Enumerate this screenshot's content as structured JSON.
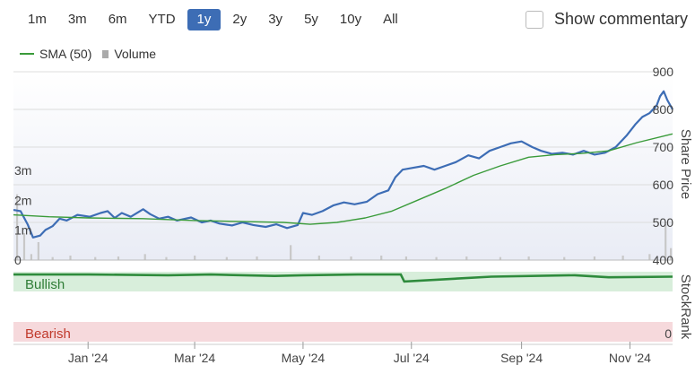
{
  "range_buttons": [
    "1m",
    "3m",
    "6m",
    "YTD",
    "1y",
    "2y",
    "3y",
    "5y",
    "10y",
    "All"
  ],
  "active_range": "1y",
  "commentary": {
    "label": "Show commentary",
    "checked": false
  },
  "legend": {
    "sma_label": "SMA (50)",
    "volume_label": "Volume"
  },
  "colors": {
    "price": "#3d6db5",
    "sma": "#3a9b3a",
    "stockrank": "#2e8b3c",
    "bullish_band": "#d8eedb",
    "bearish_band": "#f6d9dc",
    "volume": "#c8c8c8",
    "active_button": "#3d6db5"
  },
  "chart_data": {
    "type": "line",
    "price_axis": {
      "title": "Share Price",
      "ticks": [
        400,
        500,
        600,
        700,
        800,
        900
      ],
      "range": [
        400,
        900
      ]
    },
    "volume_axis": {
      "ticks": [
        "0",
        "1m",
        "2m",
        "3m"
      ],
      "values": [
        0,
        1,
        2,
        3
      ],
      "range": [
        0,
        3
      ]
    },
    "x_axis": {
      "tick_labels": [
        "Jan '24",
        "Mar '24",
        "May '24",
        "Jul '24",
        "Sep '24",
        "Nov '24"
      ],
      "tick_dates": [
        "2024-01-01",
        "2024-03-01",
        "2024-05-01",
        "2024-07-01",
        "2024-09-01",
        "2024-11-01"
      ],
      "range": [
        "2023-11-20",
        "2024-11-25"
      ]
    },
    "series": [
      {
        "name": "",
        "role": "price",
        "points": [
          [
            "2023-11-20",
            533
          ],
          [
            "2023-11-24",
            530
          ],
          [
            "2023-11-28",
            495
          ],
          [
            "2023-12-01",
            460
          ],
          [
            "2023-12-05",
            465
          ],
          [
            "2023-12-08",
            480
          ],
          [
            "2023-12-12",
            490
          ],
          [
            "2023-12-16",
            510
          ],
          [
            "2023-12-20",
            505
          ],
          [
            "2023-12-26",
            520
          ],
          [
            "2024-01-02",
            515
          ],
          [
            "2024-01-08",
            525
          ],
          [
            "2024-01-12",
            530
          ],
          [
            "2024-01-16",
            512
          ],
          [
            "2024-01-20",
            525
          ],
          [
            "2024-01-25",
            515
          ],
          [
            "2024-02-01",
            535
          ],
          [
            "2024-02-05",
            522
          ],
          [
            "2024-02-10",
            510
          ],
          [
            "2024-02-15",
            515
          ],
          [
            "2024-02-20",
            505
          ],
          [
            "2024-02-28",
            513
          ],
          [
            "2024-03-05",
            500
          ],
          [
            "2024-03-10",
            505
          ],
          [
            "2024-03-15",
            497
          ],
          [
            "2024-03-22",
            492
          ],
          [
            "2024-03-28",
            500
          ],
          [
            "2024-04-03",
            493
          ],
          [
            "2024-04-10",
            488
          ],
          [
            "2024-04-16",
            495
          ],
          [
            "2024-04-22",
            485
          ],
          [
            "2024-04-28",
            493
          ],
          [
            "2024-05-01",
            525
          ],
          [
            "2024-05-06",
            520
          ],
          [
            "2024-05-12",
            530
          ],
          [
            "2024-05-18",
            545
          ],
          [
            "2024-05-24",
            553
          ],
          [
            "2024-05-30",
            548
          ],
          [
            "2024-06-06",
            555
          ],
          [
            "2024-06-12",
            575
          ],
          [
            "2024-06-18",
            585
          ],
          [
            "2024-06-22",
            620
          ],
          [
            "2024-06-26",
            640
          ],
          [
            "2024-07-02",
            645
          ],
          [
            "2024-07-08",
            650
          ],
          [
            "2024-07-14",
            640
          ],
          [
            "2024-07-20",
            650
          ],
          [
            "2024-07-26",
            660
          ],
          [
            "2024-08-02",
            678
          ],
          [
            "2024-08-08",
            670
          ],
          [
            "2024-08-14",
            690
          ],
          [
            "2024-08-20",
            700
          ],
          [
            "2024-08-26",
            710
          ],
          [
            "2024-09-01",
            715
          ],
          [
            "2024-09-07",
            700
          ],
          [
            "2024-09-12",
            690
          ],
          [
            "2024-09-18",
            682
          ],
          [
            "2024-09-24",
            685
          ],
          [
            "2024-09-30",
            680
          ],
          [
            "2024-10-06",
            690
          ],
          [
            "2024-10-12",
            680
          ],
          [
            "2024-10-18",
            685
          ],
          [
            "2024-10-24",
            700
          ],
          [
            "2024-10-30",
            730
          ],
          [
            "2024-11-04",
            760
          ],
          [
            "2024-11-08",
            780
          ],
          [
            "2024-11-12",
            790
          ],
          [
            "2024-11-16",
            810
          ],
          [
            "2024-11-18",
            835
          ],
          [
            "2024-11-20",
            848
          ],
          [
            "2024-11-22",
            825
          ],
          [
            "2024-11-25",
            800
          ]
        ]
      },
      {
        "name": "SMA (50)",
        "role": "sma",
        "points": [
          [
            "2023-11-20",
            520
          ],
          [
            "2023-12-10",
            515
          ],
          [
            "2024-01-01",
            512
          ],
          [
            "2024-02-01",
            510
          ],
          [
            "2024-03-01",
            505
          ],
          [
            "2024-04-01",
            502
          ],
          [
            "2024-04-20",
            500
          ],
          [
            "2024-05-05",
            495
          ],
          [
            "2024-05-20",
            500
          ],
          [
            "2024-06-05",
            512
          ],
          [
            "2024-06-20",
            530
          ],
          [
            "2024-07-05",
            560
          ],
          [
            "2024-07-20",
            590
          ],
          [
            "2024-08-05",
            625
          ],
          [
            "2024-08-20",
            650
          ],
          [
            "2024-09-05",
            673
          ],
          [
            "2024-09-20",
            680
          ],
          [
            "2024-10-05",
            683
          ],
          [
            "2024-10-20",
            690
          ],
          [
            "2024-11-05",
            712
          ],
          [
            "2024-11-25",
            735
          ]
        ]
      }
    ],
    "volume": [
      [
        "2023-11-22",
        2.2
      ],
      [
        "2023-11-26",
        0.9
      ],
      [
        "2023-11-30",
        0.2
      ],
      [
        "2023-12-04",
        0.6
      ],
      [
        "2023-12-12",
        0.1
      ],
      [
        "2023-12-22",
        0.15
      ],
      [
        "2024-01-05",
        0.1
      ],
      [
        "2024-01-18",
        0.12
      ],
      [
        "2024-02-02",
        0.2
      ],
      [
        "2024-02-14",
        0.1
      ],
      [
        "2024-03-01",
        0.15
      ],
      [
        "2024-03-19",
        0.1
      ],
      [
        "2024-04-05",
        0.12
      ],
      [
        "2024-04-24",
        0.5
      ],
      [
        "2024-05-10",
        0.15
      ],
      [
        "2024-05-28",
        0.12
      ],
      [
        "2024-06-14",
        0.15
      ],
      [
        "2024-06-28",
        0.12
      ],
      [
        "2024-07-15",
        0.1
      ],
      [
        "2024-08-01",
        0.12
      ],
      [
        "2024-08-20",
        0.1
      ],
      [
        "2024-09-05",
        0.12
      ],
      [
        "2024-09-25",
        0.1
      ],
      [
        "2024-10-12",
        0.12
      ],
      [
        "2024-10-28",
        0.15
      ],
      [
        "2024-11-12",
        0.2
      ],
      [
        "2024-11-21",
        1.2
      ],
      [
        "2024-11-24",
        0.4
      ]
    ],
    "stockrank": {
      "title": "StockRank",
      "bullish_label": "Bullish",
      "bearish_label": "Bearish",
      "zero_label": "0",
      "range": [
        0,
        100
      ],
      "points": [
        [
          "2023-11-20",
          96
        ],
        [
          "2024-01-01",
          96
        ],
        [
          "2024-02-15",
          95
        ],
        [
          "2024-03-10",
          96
        ],
        [
          "2024-04-15",
          94
        ],
        [
          "2024-05-01",
          95
        ],
        [
          "2024-06-01",
          96
        ],
        [
          "2024-06-25",
          96
        ],
        [
          "2024-06-27",
          86
        ],
        [
          "2024-08-15",
          93
        ],
        [
          "2024-10-01",
          95
        ],
        [
          "2024-10-20",
          92
        ],
        [
          "2024-11-25",
          93
        ]
      ]
    }
  }
}
